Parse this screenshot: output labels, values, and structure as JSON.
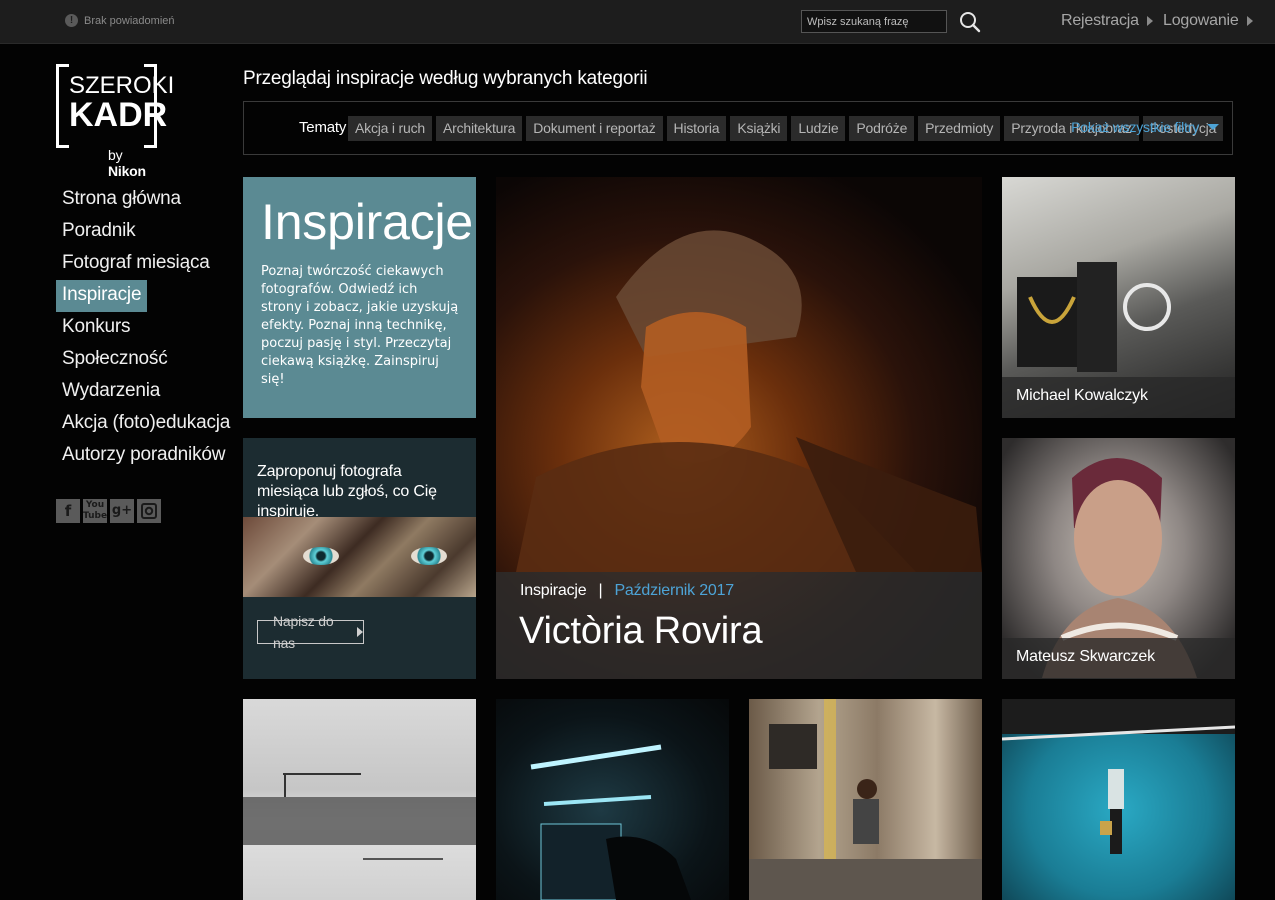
{
  "topbar": {
    "notifications": "Brak powiadomień",
    "search_placeholder": "Wpisz szukaną frazę",
    "register": "Rejestracja",
    "login": "Logowanie"
  },
  "logo": {
    "line1": "SZEROKI",
    "line2": "KADR",
    "by": "by",
    "brand": "Nikon"
  },
  "nav": {
    "items": [
      "Strona główna",
      "Poradnik",
      "Fotograf miesiąca",
      "Inspiracje",
      "Konkurs",
      "Społeczność",
      "Wydarzenia",
      "Akcja (foto)edukacja",
      "Autorzy poradników"
    ],
    "active": "Inspiracje"
  },
  "social": {
    "icons": [
      "facebook-icon",
      "youtube-icon",
      "googleplus-icon",
      "instagram-icon"
    ]
  },
  "categories": {
    "title": "Przeglądaj inspiracje według wybranych kategorii",
    "label": "Tematy",
    "chips": [
      "Akcja i ruch",
      "Architektura",
      "Dokument i reportaż",
      "Historia",
      "Książki",
      "Ludzie",
      "Podróże",
      "Przedmioty",
      "Przyroda i krajobraz",
      "Postedycja"
    ],
    "show_all": "Pokaż wszystkie filtry"
  },
  "inspiration_box": {
    "title": "Inspiracje",
    "text": "Poznaj twórczość ciekawych fotografów. Odwiedź ich strony i  zobacz, jakie uzyskują efekty. Poznaj inną technikę, poczuj pasję i styl. Przeczytaj ciekawą książkę. Zainspiruj się!"
  },
  "propose_box": {
    "text": "Zaproponuj fotografa miesiąca lub zgłoś, co Cię inspiruje.",
    "button": "Napisz do nas"
  },
  "feature": {
    "category": "Inspiracje",
    "separator": "|",
    "date": "Październik 2017",
    "title": "Victòria Rovira"
  },
  "side_tiles": [
    {
      "name": "Michael Kowalczyk"
    },
    {
      "name": "Mateusz Skwarczek"
    }
  ],
  "colors": {
    "accent_teal": "#5b8a93",
    "link_blue": "#4da3d6",
    "topbar": "#1d1d1d",
    "background": "#030303"
  }
}
